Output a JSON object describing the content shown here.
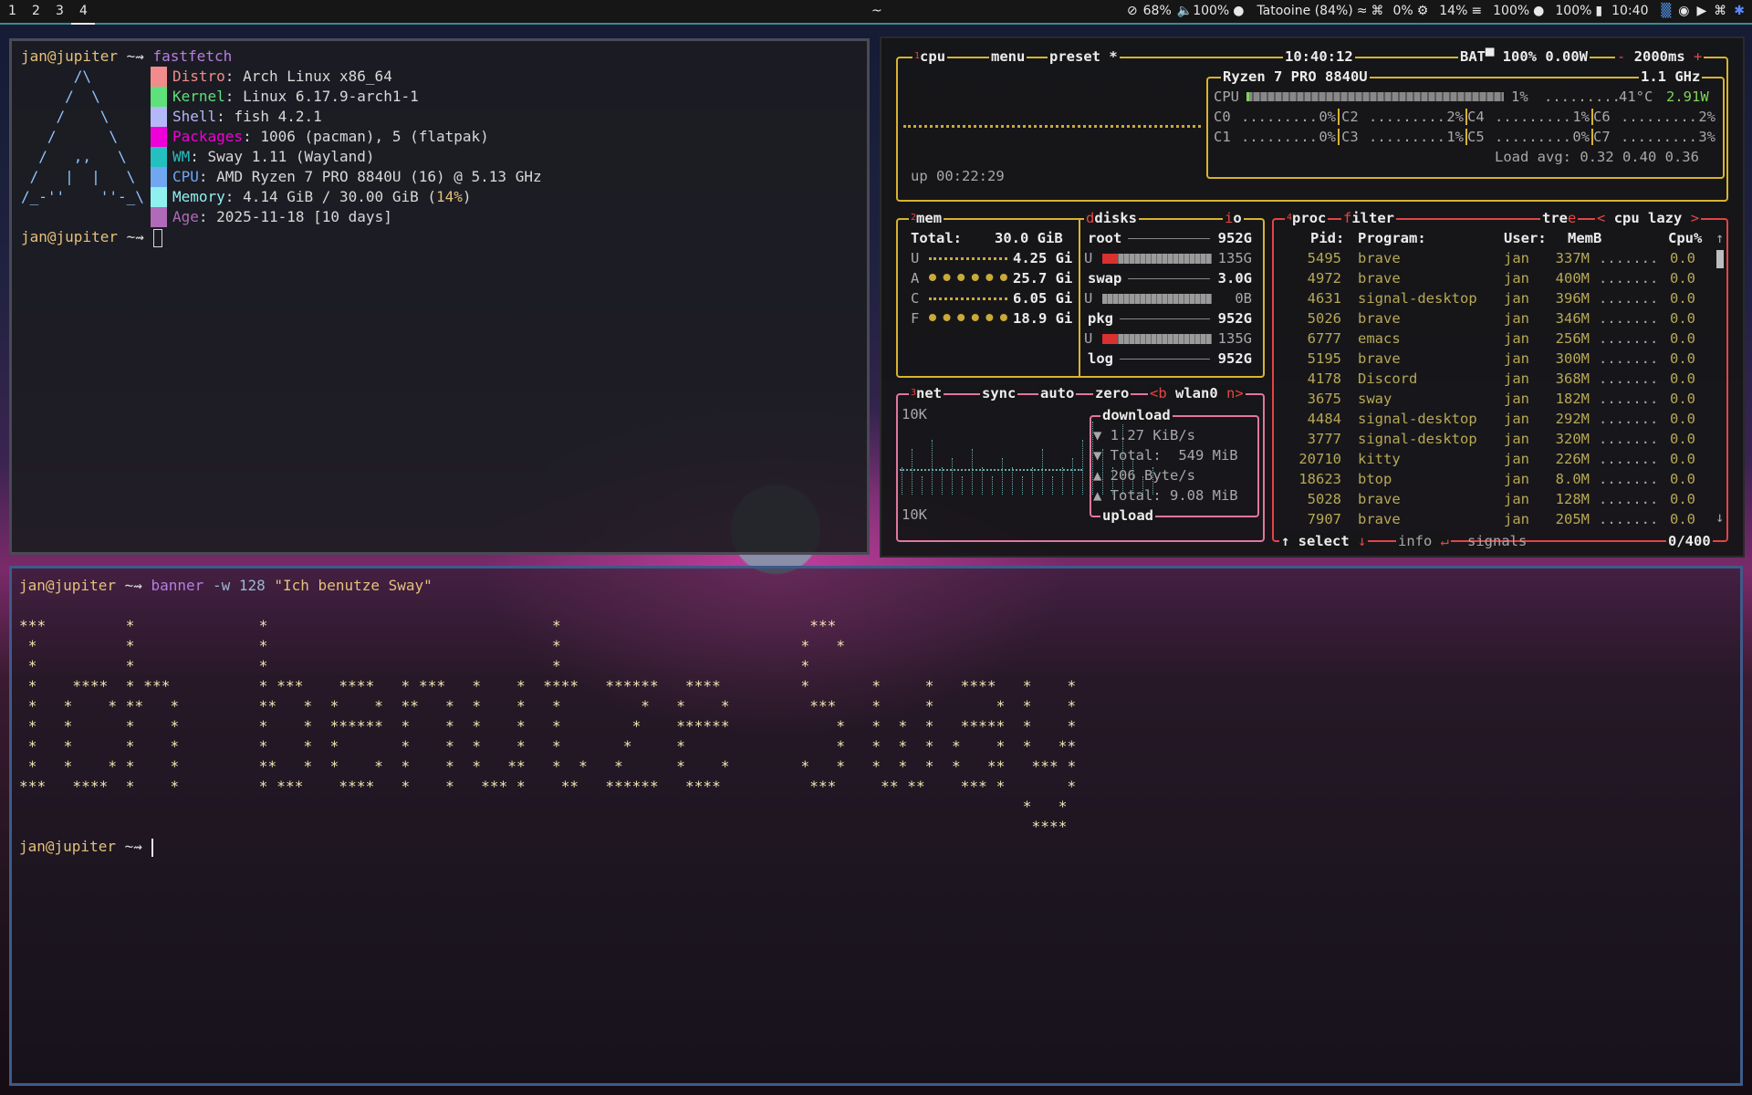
{
  "topbar": {
    "workspaces": [
      "1",
      "2",
      "3",
      "4"
    ],
    "active_workspace": "4",
    "window_title": "~",
    "status": {
      "idle": "68%",
      "volume": "100%",
      "mic": "",
      "network": "Tatooine (84%)",
      "cpu": "0%",
      "memory": "14%",
      "brightness": "100%",
      "battery": "100%",
      "clock": "10:40"
    },
    "icons": [
      "eye-slash-icon",
      "speaker-icon",
      "microphone-icon",
      "wifi-icon",
      "bluetooth-icon",
      "cpu-icon",
      "memory-icon",
      "brightness-icon",
      "battery-icon",
      "signal-bars-icon",
      "discord-icon",
      "tidal-icon",
      "bluetooth-tray-icon",
      "app-tray-icon"
    ]
  },
  "fastfetch_term": {
    "prompt_user": "jan@jupiter",
    "prompt_arrow": "~⇝",
    "command": "fastfetch",
    "logo_lines": [
      "      /\\",
      "     /  \\",
      "    /    \\",
      "   /      \\",
      "  /   ,,   \\",
      " /   |  |   \\",
      "/_-''    ''-_\\"
    ],
    "info": [
      {
        "key": "Distro",
        "value": ": Arch Linux x86_64",
        "color": "#f28b8b"
      },
      {
        "key": "Kernel",
        "value": ": Linux 6.17.9-arch1-1",
        "color": "#5ee07a"
      },
      {
        "key": "Shell",
        "value": ": fish 4.2.1",
        "color": "#b4b8f8"
      },
      {
        "key": "Packages",
        "value": ": 1006 (pacman), 5 (flatpak)",
        "color": "#f000d8"
      },
      {
        "key": "WM",
        "value": ": Sway 1.11 (Wayland)",
        "color": "#24c0c0"
      },
      {
        "key": "CPU",
        "value": ": AMD Ryzen 7 PRO 8840U (16) @ 5.13 GHz",
        "color": "#6fa8f0"
      },
      {
        "key": "Memory",
        "value": ": 4.14 GiB / 30.00 GiB (",
        "value_pct": "14%",
        "value_end": ")",
        "color": "#8ff0f0"
      },
      {
        "key": "Age",
        "value": ": 2025-11-18 [10 days]",
        "color": "#b06ab8"
      }
    ],
    "prompt2_user": "jan@jupiter",
    "prompt2_arrow": "~⇝"
  },
  "btop": {
    "cpu_box": {
      "tab_num": "1",
      "tab_cpu": "cpu",
      "tab_menu": "menu",
      "tab_preset": "preset *",
      "clock": "10:40:12",
      "battery": "BAT▀ 100% 0.00W",
      "interval_minus": "-",
      "interval": "2000ms",
      "interval_plus": "+",
      "uptime": "up 00:22:29",
      "model": "Ryzen 7 PRO 8840U",
      "freq": "1.1 GHz",
      "cpu_label": "CPU",
      "cpu_pct": "1%",
      "cpu_pct_value": 1,
      "temp": "41°C",
      "power": "2.91W",
      "cores": [
        {
          "name": "C0",
          "pct": "0%"
        },
        {
          "name": "C2",
          "pct": "2%"
        },
        {
          "name": "C4",
          "pct": "1%"
        },
        {
          "name": "C6",
          "pct": "2%"
        },
        {
          "name": "C1",
          "pct": "0%"
        },
        {
          "name": "C3",
          "pct": "1%"
        },
        {
          "name": "C5",
          "pct": "0%"
        },
        {
          "name": "C7",
          "pct": "3%"
        }
      ],
      "load_avg": "Load avg: 0.32 0.40 0.36"
    },
    "mem_box": {
      "tab_num": "2",
      "title": "mem",
      "total_label": "Total:",
      "total": "30.0 GiB",
      "rows": [
        {
          "label": "U",
          "value": "4.25 Gi"
        },
        {
          "label": "A",
          "value": "25.7 Gi"
        },
        {
          "label": "C",
          "value": "6.05 Gi"
        },
        {
          "label": "F",
          "value": "18.9 Gi"
        }
      ],
      "disks_title": "disks",
      "io_title": "io",
      "disks": [
        {
          "name": "root",
          "size": "952G",
          "used": "135G",
          "used_fraction": 0.14
        },
        {
          "name": "swap",
          "size": "3.0G",
          "used": "0B",
          "used_fraction": 0.0
        },
        {
          "name": "pkg",
          "size": "952G",
          "used": "135G",
          "used_fraction": 0.14
        },
        {
          "name": "log",
          "size": "952G"
        }
      ],
      "disk_used_label": "U"
    },
    "net_box": {
      "tab_num": "3",
      "title": "net",
      "sync": "sync",
      "auto": "auto",
      "zero": "zero",
      "prev": "<b",
      "iface": "wlan0",
      "next": "n>",
      "scale_top": "10K",
      "scale_bottom": "10K",
      "download_title": "download",
      "upload_title": "upload",
      "down_rate": "▼ 1.27 KiB/s",
      "down_total": "▼ Total:  549 MiB",
      "up_rate": "▲ 206 Byte/s",
      "up_total": "▲ Total: 9.08 MiB"
    },
    "proc_box": {
      "tab_num": "4",
      "title": "proc",
      "filter": "filter",
      "tree": "tree",
      "sort": "< cpu lazy >",
      "headers": {
        "pid": "Pid:",
        "program": "Program:",
        "user": "User:",
        "memb": "MemB",
        "cpu": "Cpu%"
      },
      "rows": [
        {
          "pid": "5495",
          "program": "brave",
          "user": "jan",
          "mem": "337M",
          "cpu": "0.0"
        },
        {
          "pid": "4972",
          "program": "brave",
          "user": "jan",
          "mem": "400M",
          "cpu": "0.0"
        },
        {
          "pid": "4631",
          "program": "signal-desktop",
          "user": "jan",
          "mem": "396M",
          "cpu": "0.0"
        },
        {
          "pid": "5026",
          "program": "brave",
          "user": "jan",
          "mem": "346M",
          "cpu": "0.0"
        },
        {
          "pid": "6777",
          "program": "emacs",
          "user": "jan",
          "mem": "256M",
          "cpu": "0.0"
        },
        {
          "pid": "5195",
          "program": "brave",
          "user": "jan",
          "mem": "300M",
          "cpu": "0.0"
        },
        {
          "pid": "4178",
          "program": "Discord",
          "user": "jan",
          "mem": "368M",
          "cpu": "0.0"
        },
        {
          "pid": "3675",
          "program": "sway",
          "user": "jan",
          "mem": "182M",
          "cpu": "0.0"
        },
        {
          "pid": "4484",
          "program": "signal-desktop",
          "user": "jan",
          "mem": "292M",
          "cpu": "0.0"
        },
        {
          "pid": "3777",
          "program": "signal-desktop",
          "user": "jan",
          "mem": "320M",
          "cpu": "0.0"
        },
        {
          "pid": "20710",
          "program": "kitty",
          "user": "jan",
          "mem": "226M",
          "cpu": "0.0"
        },
        {
          "pid": "18623",
          "program": "btop",
          "user": "jan",
          "mem": "8.0M",
          "cpu": "0.0"
        },
        {
          "pid": "5028",
          "program": "brave",
          "user": "jan",
          "mem": "128M",
          "cpu": "0.0"
        },
        {
          "pid": "7907",
          "program": "brave",
          "user": "jan",
          "mem": "205M",
          "cpu": "0.0"
        }
      ],
      "footer_select": "↑ select ↓",
      "footer_info": "info ↵",
      "footer_signals": "signals",
      "count": "0/400"
    }
  },
  "banner_term": {
    "prompt_user": "jan@jupiter",
    "prompt_arrow": "~⇝",
    "command": "banner",
    "args": "-w 128",
    "string": "\"Ich benutze Sway\"",
    "ascii_lines": [
      "***         *              *                                *                            ***",
      " *          *              *                                *                           *   *",
      " *          *              *                                *                           *",
      " *    ****  * ***          * ***    ****   * ***   *    *  ****   ******   ****         *       *     *   ****   *    *",
      " *   *    * **   *         **   *  *    *  **   *  *    *   *         *   *    *         ***    *     *       *  *    *",
      " *   *      *    *         *    *  ******  *    *  *    *   *        *    ******            *   *  *  *   *****  *    *",
      " *   *      *    *         *    *  *       *    *  *    *   *       *     *                 *   *  *  *  *    *  *   **",
      " *   *    * *    *         **   *  *    *  *    *  *   **   *  *   *      *    *        *   *   *  *  *  *   **   *** *",
      "***   ****  *    *         * ***    ****   *    *   *** *    **   ******   ****          ***     ** **    *** *       *",
      "                                                                                                                 *   *",
      "                                                                                                                  ****"
    ],
    "prompt2_user": "jan@jupiter",
    "prompt2_arrow": "~⇝"
  }
}
